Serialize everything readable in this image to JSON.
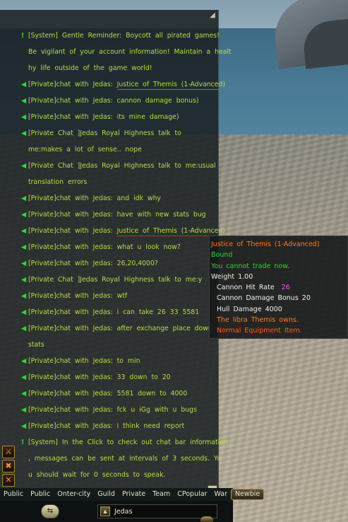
{
  "chat": {
    "lines": [
      {
        "text": "[System]  Gentle  Reminder:  Boycott  all  pirated  games!",
        "bullet": "!"
      },
      {
        "text": "Be  vigilant  of  your  account  information!  Maintain  a  healt",
        "bullet": ""
      },
      {
        "text": "hy  life  outside  of  the  game  world!",
        "bullet": ""
      },
      {
        "prefix": "[Private]chat  with  Jedas:  ",
        "link": "Justice  of  Themis  (1-Advanced)",
        "bullet": "◀"
      },
      {
        "text": "[Private]chat  with  Jedas:  cannon  damage  bonus)",
        "bullet": "◀"
      },
      {
        "text": "[Private]chat  with  Jedas:  its  mine  damage)",
        "bullet": "◀"
      },
      {
        "text": "[Private  Chat    ]Jedas  Royal  Highness  talk  to",
        "bullet": "◀"
      },
      {
        "text": "me:makes  a  lot  of  sense..  nope",
        "bullet": ""
      },
      {
        "text": "[Private  Chat    ]Jedas  Royal  Highness  talk  to  me:usual",
        "bullet": "◀"
      },
      {
        "text": "translation  errors",
        "bullet": ""
      },
      {
        "text": "[Private]chat  with  Jedas:  and  idk  why",
        "bullet": "◀"
      },
      {
        "text": "[Private]chat  with  Jedas:  have  with  new  stats  bug",
        "bullet": "◀"
      },
      {
        "prefix": "[Private]chat  with  Jedas:  ",
        "link2": "Justice  of  Themis  (1-Advanced)",
        "bullet": "◀"
      },
      {
        "text": "[Private]chat  with  Jedas:  what  u  look  now?",
        "bullet": "◀"
      },
      {
        "text": "[Private]chat  with  Jedas:  26,20,4000?",
        "bullet": "◀"
      },
      {
        "text": "[Private  Chat    ]Jedas  Royal  Highness  talk  to  me:y",
        "bullet": "◀"
      },
      {
        "text": "[Private]chat  with  Jedas:  wtf",
        "bullet": "◀"
      },
      {
        "text": "[Private]chat  with  Jedas:  i  can  take  26  33  5581",
        "bullet": "◀"
      },
      {
        "text": "[Private]chat  with  Jedas:  after  exchange  place  down  a",
        "bullet": "◀"
      },
      {
        "text": "stats",
        "bullet": ""
      },
      {
        "text": "[Private]chat  with  Jedas:  to  min",
        "bullet": "◀"
      },
      {
        "text": "[Private]chat  with  Jedas:  33  down  to  20",
        "bullet": "◀"
      },
      {
        "text": "[Private]chat  with  Jedas:  5581  down  to  4000",
        "bullet": "◀"
      },
      {
        "text": "[Private]chat  with  Jedas:  fck  u  iGg  with  u  bugs",
        "bullet": "◀"
      },
      {
        "text": "[Private]chat  with  Jedas:  i  think  need  report",
        "bullet": "◀"
      },
      {
        "text": "[System]  In  the  Click  to  check  out  chat  bar  information",
        "bullet": "!"
      },
      {
        "text": ",  messages  can  be  sent  at  intervals  of  3  seconds.  Yo",
        "bullet": ""
      },
      {
        "text": "u  should  wait  for  0  seconds  to  speak.",
        "bullet": ""
      }
    ]
  },
  "tabs": [
    "Public",
    "Public",
    "Onter-city",
    "Guild",
    "Private",
    "Team",
    "CPopular",
    "War",
    "Newbie"
  ],
  "active_tab_index": 8,
  "input": {
    "target_name": "Jedas"
  },
  "tooltip": {
    "item_name": "Justice  of  Themis  (1-Advanced)",
    "bound": "Bound",
    "trade": "You  cannot  trade  now.",
    "weight": "Weight  1.00",
    "stat1_label": "Cannon    Hit    Rate",
    "stat1_value": "26",
    "stat2": "Cannon    Damage    Bonus    20",
    "stat3": "Hull    Damage    4000",
    "lore": "The    libra    Themis    owns.",
    "quality": "Normal    Equipment    Item."
  },
  "colors": {
    "chat_text": "#b7dd44",
    "bullet": "#35d435",
    "item_orange": "#ff7a1e",
    "bound_green": "#33d133",
    "highlight_pink": "#ff48ff"
  }
}
